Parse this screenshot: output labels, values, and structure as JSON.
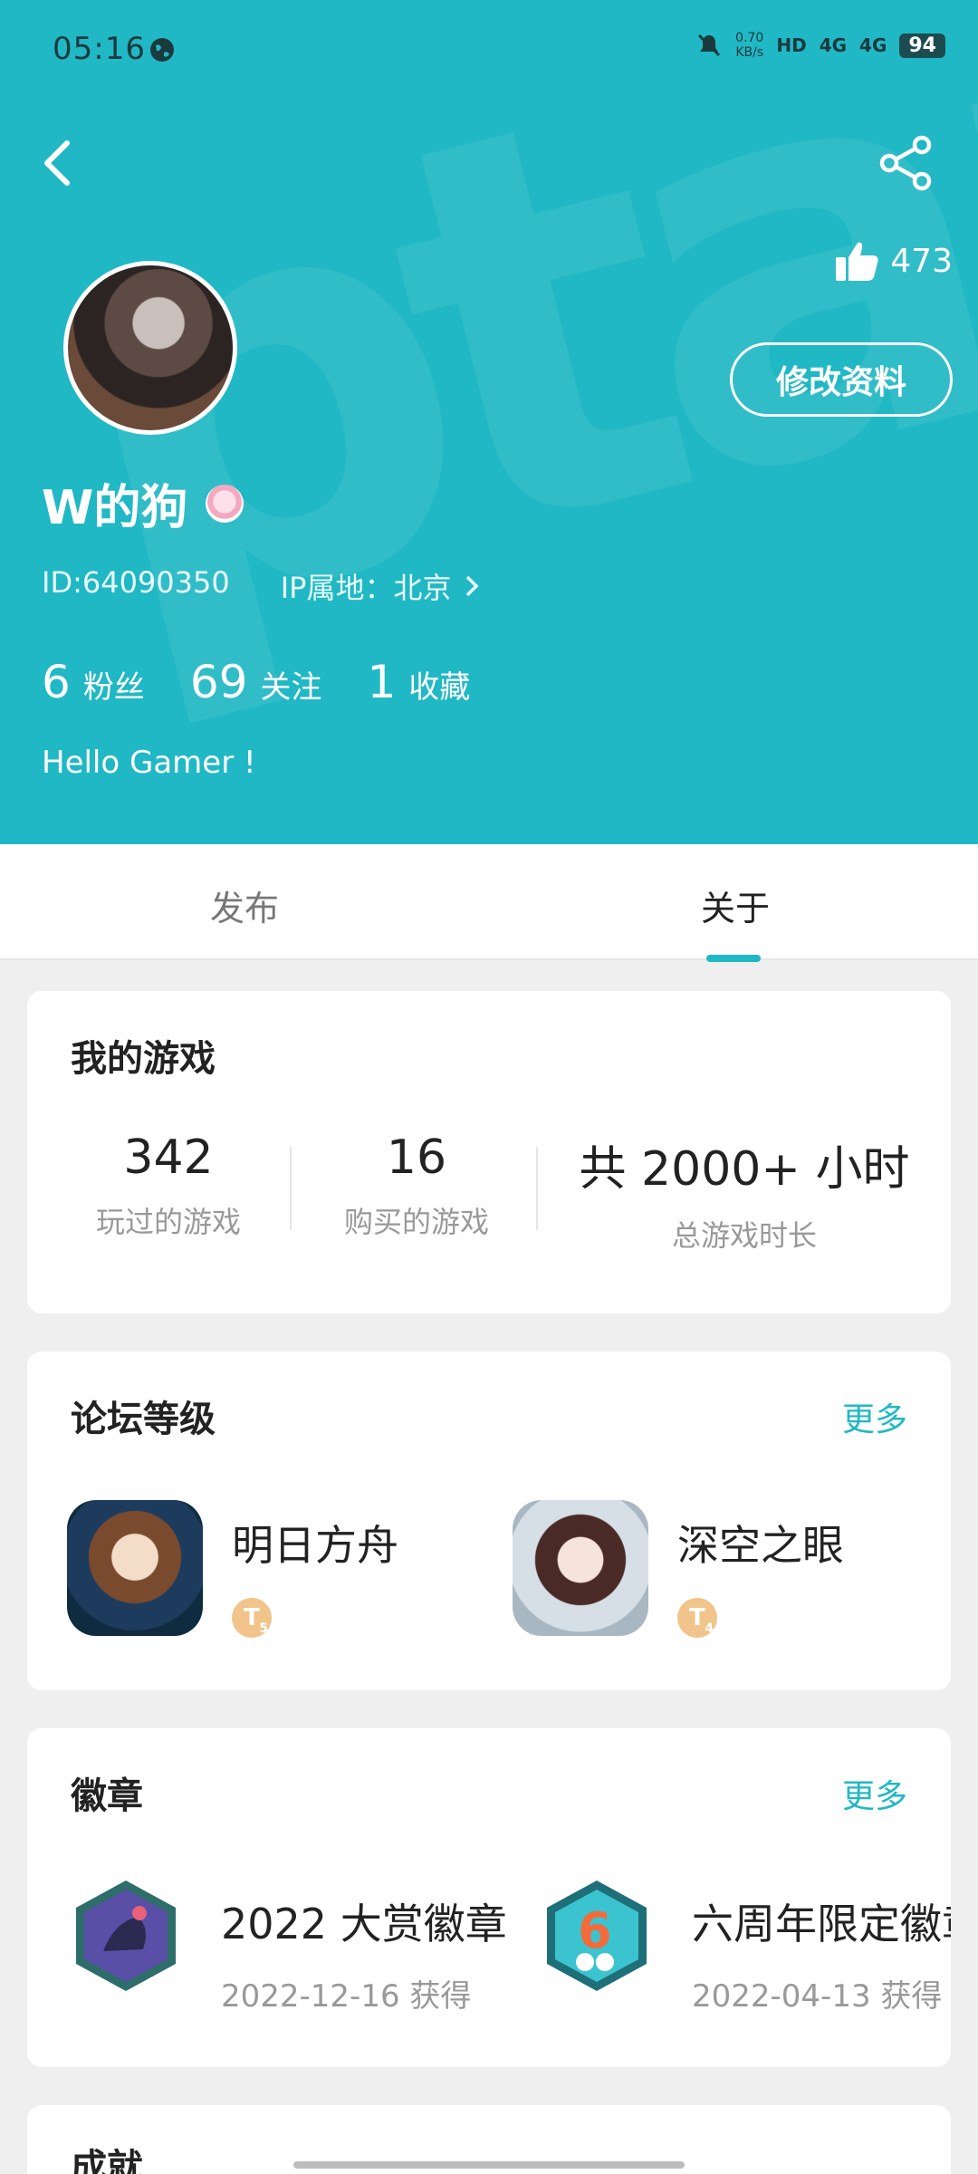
{
  "status_bar": {
    "time": "05:16",
    "net_speed": "0.70",
    "net_unit": "KB/s",
    "hd": "HD",
    "sig1": "4G",
    "sig2": "4G",
    "battery": "94"
  },
  "header": {
    "likes": "473",
    "edit_profile": "修改资料",
    "username": "W的狗",
    "user_id": "ID:64090350",
    "ip_location": "IP属地：北京",
    "stats": [
      {
        "value": "6",
        "label": "粉丝"
      },
      {
        "value": "69",
        "label": "关注"
      },
      {
        "value": "1",
        "label": "收藏"
      }
    ],
    "bio": "Hello Gamer !",
    "background_color": "#20b8c4"
  },
  "tabs": [
    {
      "label": "发布"
    },
    {
      "label": "关于",
      "active": true
    }
  ],
  "my_games": {
    "title": "我的游戏",
    "stats": [
      {
        "value": "342",
        "label": "玩过的游戏"
      },
      {
        "value": "16",
        "label": "购买的游戏"
      },
      {
        "value": "共 2000+ 小时",
        "label": "总游戏时长"
      }
    ]
  },
  "forum_level": {
    "title": "论坛等级",
    "more": "更多",
    "items": [
      {
        "name": "明日方舟",
        "level": "T",
        "level_num": "5",
        "icon": "arknights-game-icon"
      },
      {
        "name": "深空之眼",
        "level": "T",
        "level_num": "4",
        "icon": "aether-gazer-game-icon"
      }
    ]
  },
  "badges": {
    "title": "徽章",
    "more": "更多",
    "items": [
      {
        "name": "2022 大赏徽章",
        "date": "2022-12-16 获得"
      },
      {
        "name": "六周年限定徽章",
        "date": "2022-04-13 获得"
      }
    ]
  },
  "achievements": {
    "title": "成就"
  },
  "colors": {
    "accent": "#20b8c4",
    "level_badge": "#f0c48a"
  }
}
